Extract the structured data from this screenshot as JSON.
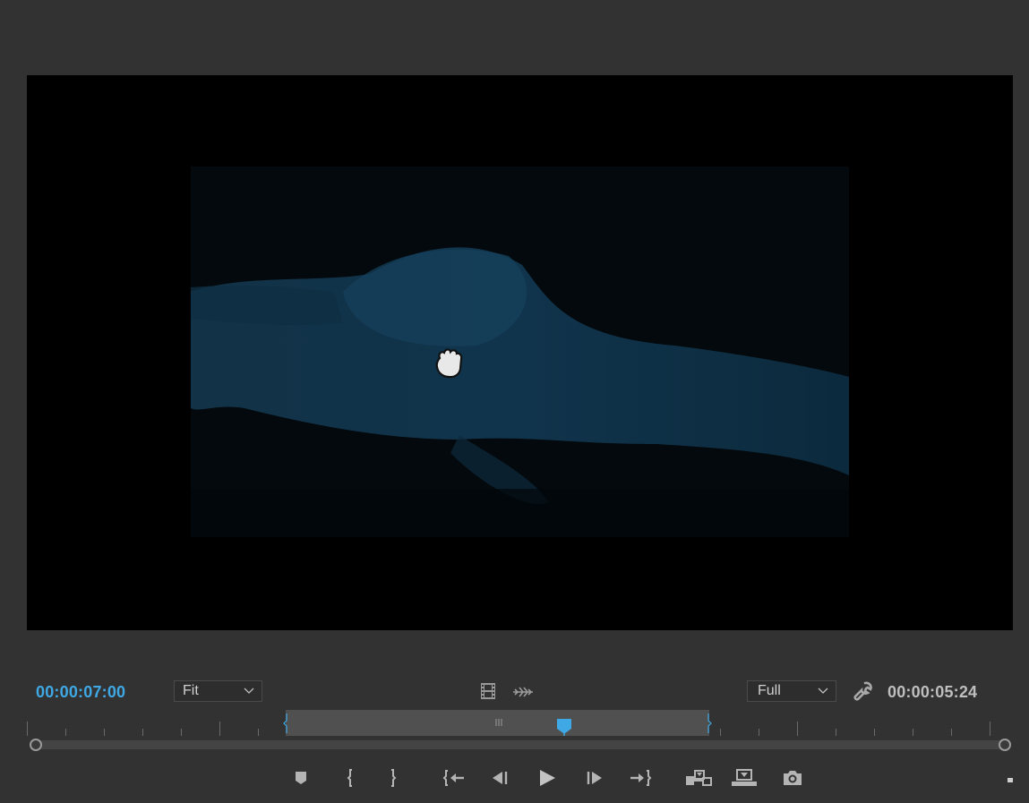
{
  "monitor": {
    "current_timecode": "00:00:07:00",
    "duration_timecode": "00:00:05:24",
    "zoom_value": "Fit",
    "quality_value": "Full"
  },
  "toolbar": {
    "icons": [
      "film-icon",
      "audio-waveform-icon",
      "wrench-icon"
    ]
  },
  "transport": {
    "buttons": [
      "add-marker-button",
      "mark-in-button",
      "mark-out-button",
      "go-to-in-button",
      "step-back-button",
      "play-button",
      "step-forward-button",
      "go-to-out-button",
      "insert-button",
      "overwrite-button",
      "export-frame-button"
    ]
  },
  "colors": {
    "accent": "#3fa9e6",
    "panel_bg": "#323232",
    "viewer_bg": "#000000"
  }
}
